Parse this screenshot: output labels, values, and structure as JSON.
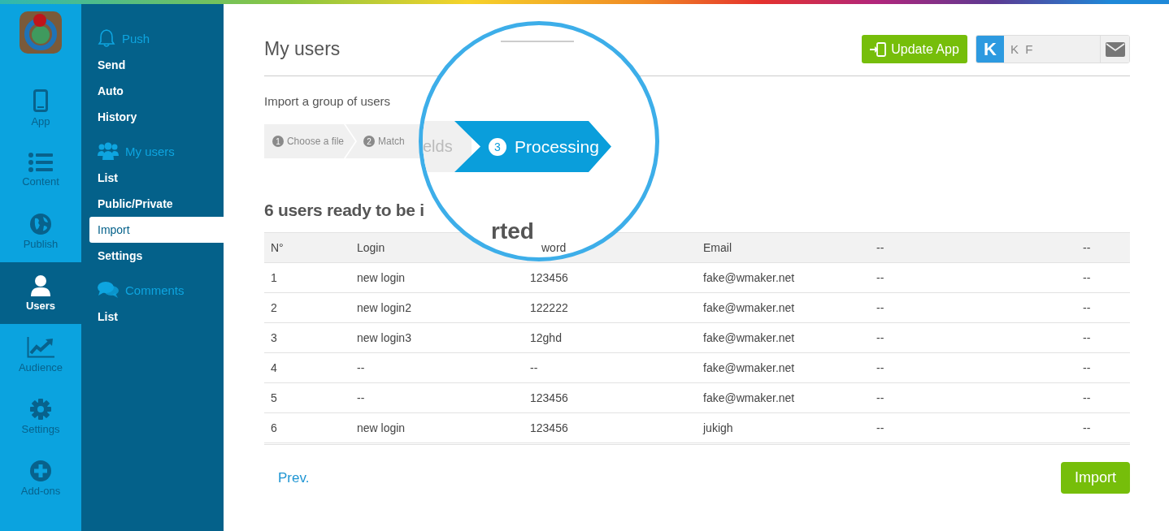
{
  "rail": [
    {
      "label": "App",
      "selected": false
    },
    {
      "label": "Content",
      "selected": false
    },
    {
      "label": "Publish",
      "selected": false
    },
    {
      "label": "Users",
      "selected": true
    },
    {
      "label": "Audience",
      "selected": false
    },
    {
      "label": "Settings",
      "selected": false
    },
    {
      "label": "Add-ons",
      "selected": false
    }
  ],
  "menu": [
    {
      "kind": "heading",
      "label": "Push"
    },
    {
      "kind": "item",
      "label": "Send",
      "selected": false
    },
    {
      "kind": "item",
      "label": "Auto",
      "selected": false
    },
    {
      "kind": "item",
      "label": "History",
      "selected": false
    },
    {
      "kind": "heading",
      "label": "My users"
    },
    {
      "kind": "item",
      "label": "List",
      "selected": false
    },
    {
      "kind": "item",
      "label": "Public/Private",
      "selected": false
    },
    {
      "kind": "item",
      "label": "Import",
      "selected": true
    },
    {
      "kind": "item",
      "label": "Settings",
      "selected": false
    },
    {
      "kind": "heading",
      "label": "Comments"
    },
    {
      "kind": "item",
      "label": "List",
      "selected": false
    }
  ],
  "title": "My users",
  "update_button": "Update App",
  "user": {
    "initial": "K",
    "name": "K F"
  },
  "subtitle": "Import a group of users",
  "steps": [
    {
      "number": "1",
      "label": "Choose a file"
    },
    {
      "number": "2",
      "label": "Match"
    }
  ],
  "magnifier": {
    "step_fragment": "elds",
    "step": {
      "number": "3",
      "label": "Processing",
      "selected": true
    },
    "heading_fragment": "rted"
  },
  "heading": "6 users ready to be i",
  "table": {
    "columns": [
      "N°",
      "Login",
      "word",
      "Email",
      "--",
      "--"
    ],
    "rows": [
      [
        "1",
        "new login",
        "123456",
        "fake@wmaker.net",
        "--",
        "--"
      ],
      [
        "2",
        "new login2",
        "122222",
        "fake@wmaker.net",
        "--",
        "--"
      ],
      [
        "3",
        "new login3",
        "12ghd",
        "fake@wmaker.net",
        "--",
        "--"
      ],
      [
        "4",
        "--",
        "--",
        "fake@wmaker.net",
        "--",
        "--"
      ],
      [
        "5",
        "--",
        "123456",
        "fake@wmaker.net",
        "--",
        "--"
      ],
      [
        "6",
        "new login",
        "123456",
        "jukigh",
        "--",
        "--"
      ]
    ]
  },
  "prev_link": "Prev.",
  "import_button": "Import"
}
